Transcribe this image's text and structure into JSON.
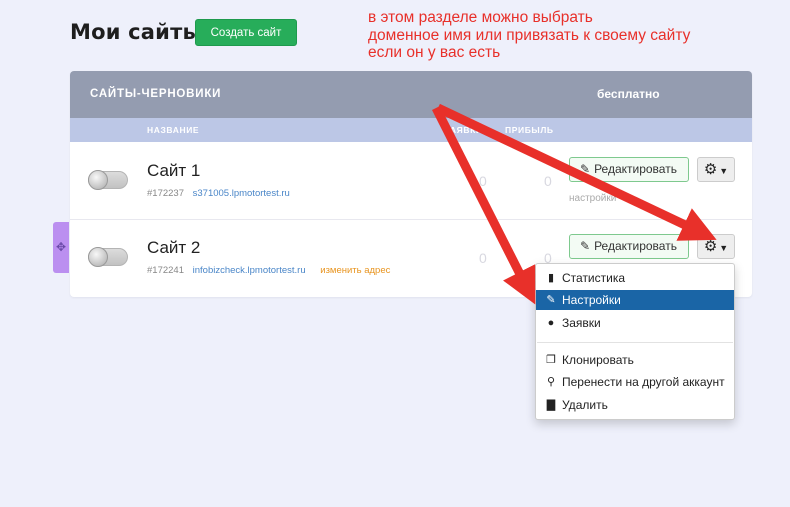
{
  "header": {
    "title": "Мои сайты",
    "create_button": "Создать сайт"
  },
  "annotation": {
    "lines": [
      "в этом разделе можно выбрать",
      "доменное имя или привязать к своему сайту",
      "если он у вас есть"
    ],
    "color": "#e8302a"
  },
  "panel": {
    "title": "САЙТЫ-ЧЕРНОВИКИ",
    "plan": "бесплатно",
    "columns": {
      "name": "НАЗВАНИЕ",
      "requests": "ЗАЯВКИ",
      "profit": "ПРИБЫЛЬ"
    }
  },
  "sites": [
    {
      "name": "Сайт 1",
      "id": "#172237",
      "domain": "s371005.lpmotortest.ru",
      "requests": "0",
      "profit": "0",
      "edit_label": "Редактировать",
      "settings_hint": "настройки"
    },
    {
      "name": "Сайт 2",
      "id": "#172241",
      "domain": "infobizcheck.lpmotortest.ru",
      "change_address": "изменить адрес",
      "requests": "0",
      "profit": "0",
      "edit_label": "Редактировать"
    }
  ],
  "dropdown": {
    "items": [
      {
        "label": "Статистика",
        "icon": "bar-chart-icon"
      },
      {
        "label": "Настройки",
        "icon": "wrench-icon",
        "active": true
      },
      {
        "label": "Заявки",
        "icon": "user-icon"
      },
      {
        "label": "Клонировать",
        "icon": "copy-icon"
      },
      {
        "label": "Перенести на другой аккаунт",
        "icon": "transfer-icon"
      },
      {
        "label": "Удалить",
        "icon": "trash-icon"
      }
    ]
  },
  "colors": {
    "accent_green": "#27ad5a",
    "header_gray": "#949cb0",
    "column_head": "#bcc7e6",
    "active_item": "#1a65a6",
    "drag_handle": "#bb8ff0"
  }
}
